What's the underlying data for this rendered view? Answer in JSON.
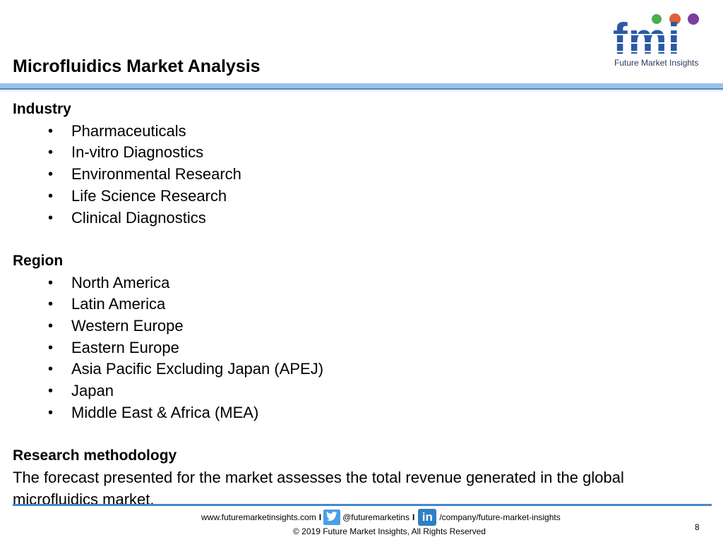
{
  "header": {
    "title": "Microfluidics Market Analysis",
    "logo": {
      "mark": "fmi",
      "tagline": "Future Market Insights",
      "icon": "fmi-logo-icon",
      "brand_color": "#2a5aa6"
    }
  },
  "sections": {
    "industry": {
      "heading": "Industry",
      "items": [
        "Pharmaceuticals",
        "In-vitro Diagnostics",
        "Environmental Research",
        "Life Science Research",
        "Clinical Diagnostics"
      ]
    },
    "region": {
      "heading": "Region",
      "items": [
        "North America",
        "Latin America",
        "Western Europe",
        "Eastern Europe",
        "Asia Pacific Excluding Japan (APEJ)",
        "Japan",
        "Middle East & Africa (MEA)"
      ]
    },
    "methodology": {
      "heading": "Research methodology",
      "text": "The forecast presented for the market assesses the total revenue generated in the global microfluidics market."
    }
  },
  "footer": {
    "website": "www.futuremarketinsights.com",
    "separator": "I",
    "twitter_handle": "@futuremarketins",
    "linkedin_label": "in",
    "linkedin_path": "/company/future-market-insights",
    "copyright": "© 2019 Future Market Insights, All Rights Reserved",
    "page_number": "8"
  },
  "colors": {
    "accent": "#4a86c8",
    "header_band": "#9cc3e6"
  }
}
